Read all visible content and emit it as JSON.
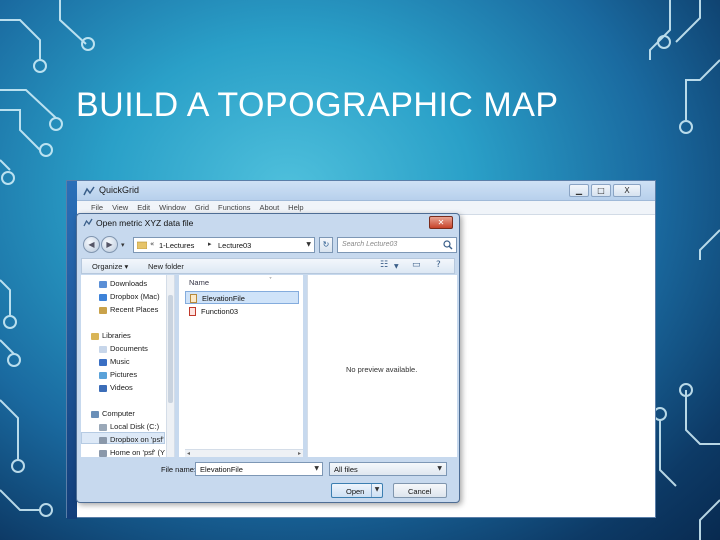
{
  "slide": {
    "title": "BUILD A TOPOGRAPHIC MAP"
  },
  "app_window": {
    "title": "QuickGrid",
    "minimize": "▁",
    "maximize": "□",
    "close": "X",
    "menu": [
      "File",
      "View",
      "Edit",
      "Window",
      "Grid",
      "Functions",
      "About",
      "Help"
    ]
  },
  "dialog": {
    "title": "Open metric XYZ data file",
    "close": "✕",
    "back": "◀",
    "forward": "▶",
    "path": [
      "1-Lectures",
      "Lecture03"
    ],
    "path_prefix": "«",
    "search_placeholder": "Search Lecture03",
    "organize": "Organize ▾",
    "new_folder": "New folder",
    "nav_items": [
      {
        "label": "Downloads",
        "color": "#5b8fd6"
      },
      {
        "label": "Dropbox (Mac)",
        "color": "#3d82d8"
      },
      {
        "label": "Recent Places",
        "color": "#c9a24a"
      },
      {
        "label": "Libraries",
        "color": "#d9b557"
      },
      {
        "label": "Documents",
        "color": "#c7d6ea"
      },
      {
        "label": "Music",
        "color": "#3a6fc4"
      },
      {
        "label": "Pictures",
        "color": "#5aa2d9"
      },
      {
        "label": "Videos",
        "color": "#3c6db8"
      },
      {
        "label": "Computer",
        "color": "#6a8fb8"
      },
      {
        "label": "Local Disk (C:)",
        "color": "#9aa8b8"
      },
      {
        "label": "Dropbox on 'psf'",
        "color": "#8a98aa"
      },
      {
        "label": "Home on 'psf' (Y",
        "color": "#8a98aa"
      }
    ],
    "column_header": "Name",
    "files": [
      {
        "label": "ElevationFile",
        "selected": true,
        "icon_color": "#d9a35a"
      },
      {
        "label": "Function03",
        "selected": false,
        "icon_color": "#d94a3a"
      }
    ],
    "preview_text": "No preview available.",
    "file_name_label": "File name:",
    "file_name_value": "ElevationFile",
    "file_type_value": "All files",
    "open_label": "Open",
    "cancel_label": "Cancel"
  }
}
